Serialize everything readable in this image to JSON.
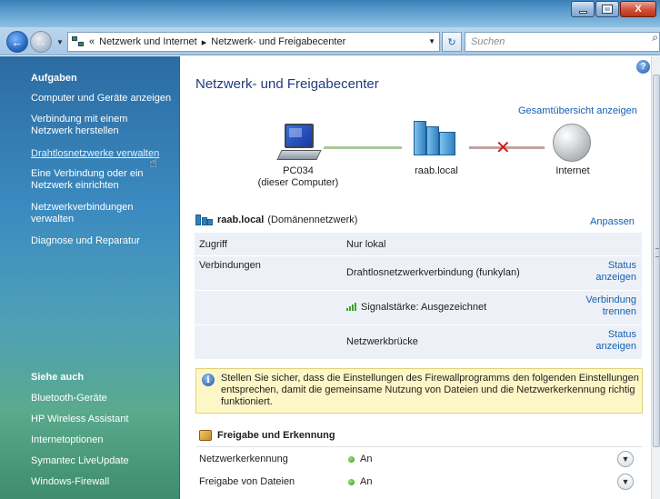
{
  "window": {
    "minimize_label": "–",
    "maximize_label": "□",
    "close_label": "X"
  },
  "navbar": {
    "breadcrumb_prefix": "«",
    "breadcrumb": [
      "Netzwerk und Internet",
      "Netzwerk- und Freigabecenter"
    ],
    "separator": "▸",
    "search_placeholder": "Suchen"
  },
  "sidebar": {
    "tasks_heading": "Aufgaben",
    "tasks": [
      "Computer und Geräte anzeigen",
      "Verbindung mit einem Netzwerk herstellen",
      "Drahtlosnetzwerke verwalten",
      "Eine Verbindung oder ein Netzwerk einrichten",
      "Netzwerkverbindungen verwalten",
      "Diagnose und Reparatur"
    ],
    "see_also_heading": "Siehe auch",
    "see_also": [
      "Bluetooth-Geräte",
      "HP Wireless Assistant",
      "Internetoptionen",
      "Symantec LiveUpdate",
      "Windows-Firewall"
    ]
  },
  "main": {
    "title": "Netzwerk- und Freigabecenter",
    "overview_link": "Gesamtübersicht anzeigen",
    "map": {
      "computer_name": "PC034",
      "computer_sub": "(dieser Computer)",
      "network_name": "raab.local",
      "internet_name": "Internet"
    },
    "network": {
      "name": "raab.local",
      "type": "(Domänennetzwerk)",
      "customize": "Anpassen",
      "access_label": "Zugriff",
      "access_value": "Nur lokal",
      "connections_label": "Verbindungen",
      "connection1": "Drahtlosnetzwerkverbindung (funkylan)",
      "connection1_action": "Status anzeigen",
      "signal": "Signalstärke: Ausgezeichnet",
      "signal_action": "Verbindung trennen",
      "connection2": "Netzwerkbrücke",
      "connection2_action": "Status anzeigen"
    },
    "info": "Stellen Sie sicher, dass die Einstellungen des Firewallprogramms den folgenden Einstellungen entsprechen, damit die gemeinsame Nutzung von Dateien und die Netzwerkerkennung richtig funktioniert.",
    "sharing": {
      "heading": "Freigabe und Erkennung",
      "rows": [
        {
          "label": "Netzwerkerkennung",
          "value": "An"
        },
        {
          "label": "Freigabe von Dateien",
          "value": "An"
        }
      ]
    }
  },
  "colors": {
    "link": "#1560b3",
    "title": "#1f3c7a",
    "status_on": "#2f9a12",
    "disconnected": "#d41818"
  }
}
